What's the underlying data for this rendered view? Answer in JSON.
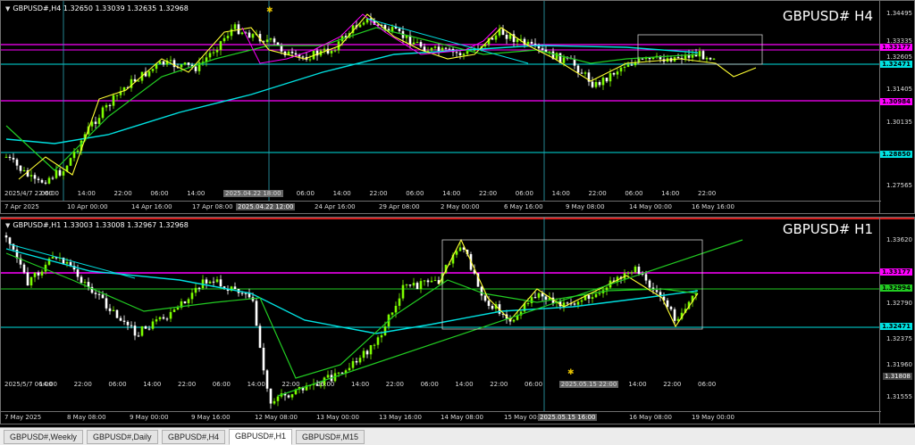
{
  "panes": [
    {
      "id": "h4",
      "header": "GBPUSD#,H4  1.32650 1.33039 1.32635 1.32968",
      "title": "GBPUSD# H4",
      "price_labels": [
        "1.34495",
        "1.33335",
        "1.33177",
        "1.32605",
        "1.32471",
        "1.31405",
        "1.30984",
        "1.30135",
        "1.28850",
        "1.27565"
      ],
      "time_labels": [
        "7 Apr 2025",
        "10 Apr 00:00",
        "14 Apr 16:00",
        "17 Apr 08:00",
        "2025.04.22 12:00",
        "24 Apr 16:00",
        "29 Apr 08:00",
        "2 May 00:00",
        "6 May 16:00",
        "9 May 08:00",
        "14 May 00:00",
        "16 May 16:00"
      ],
      "inner_time_labels": [
        "2025/4/7 22:00",
        "06:00",
        "14:00",
        "22:00",
        "06:00",
        "14:00",
        "2025.04.22 18:00",
        "22:00",
        "06:00",
        "14:00",
        "22:00",
        "06:00",
        "14:00",
        "22:00",
        "06:00",
        "14:00",
        "22:00",
        "06:00",
        "14:00",
        "22:00"
      ]
    },
    {
      "id": "h1",
      "header": "GBPUSD#,H1  1.33003 1.33008 1.32967 1.32968",
      "title": "GBPUSD# H1",
      "price_labels": [
        "1.33620",
        "1.33177",
        "1.32994",
        "1.32790",
        "1.32471",
        "1.32375",
        "1.31960",
        "1.31808",
        "1.31555"
      ],
      "time_labels": [
        "7 May 2025",
        "8 May 08:00",
        "9 May 00:00",
        "9 May 16:00",
        "12 May 08:00",
        "13 May 00:00",
        "13 May 16:00",
        "14 May 08:00",
        "15 May 00:00",
        "2025.05.15 16:00",
        "16 May 08:00",
        "19 May 00:00"
      ],
      "inner_time_labels": [
        "2025/5/7 06:00",
        "14:00",
        "22:00",
        "06:00",
        "14:00",
        "22:00",
        "06:00",
        "14:00",
        "22:00",
        "06:00",
        "14:00",
        "22:00",
        "06:00",
        "14:00",
        "22:00",
        "06:00",
        "2025.05.15 22:00",
        "06:00",
        "14:00",
        "22:00",
        "06:00"
      ]
    }
  ],
  "tabs": [
    {
      "label": "GBPUSD#,Weekly",
      "active": false
    },
    {
      "label": "GBPUSD#,Daily",
      "active": false
    },
    {
      "label": "GBPUSD#,H4",
      "active": false
    },
    {
      "label": "GBPUSD#,H1",
      "active": true
    },
    {
      "label": "GBPUSD#,M15",
      "active": false
    }
  ],
  "colors": {
    "magenta": "#ff00ff",
    "cyan": "#00e0e0",
    "green_line": "#22cc22",
    "yellow": "#ffff33",
    "bull_candle": "#7cfc00",
    "bear_candle": "#ffffff"
  }
}
